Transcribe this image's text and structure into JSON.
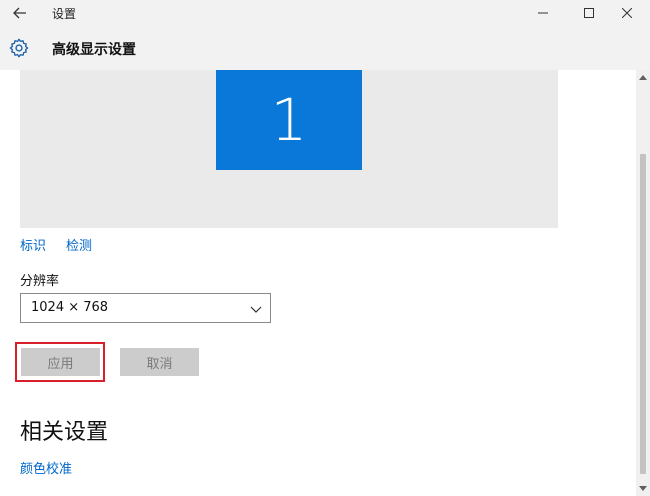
{
  "window": {
    "title": "设置"
  },
  "header": {
    "title": "高级显示设置"
  },
  "display": {
    "monitor_number": "1"
  },
  "links": {
    "identify": "标识",
    "detect": "检测"
  },
  "resolution": {
    "label": "分辨率",
    "value": "1024 × 768"
  },
  "buttons": {
    "apply": "应用",
    "cancel": "取消"
  },
  "related": {
    "title": "相关设置",
    "color_calibration": "颜色校准"
  },
  "colors": {
    "accent": "#0a78d8",
    "link": "#0066cc",
    "highlight": "#d9202a"
  }
}
